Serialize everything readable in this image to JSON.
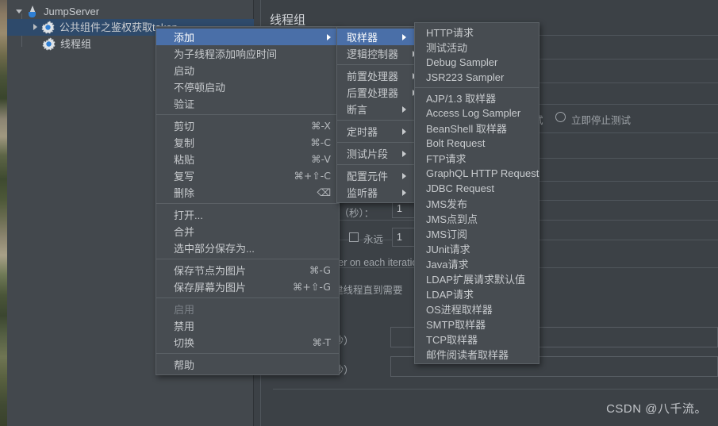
{
  "window": {
    "app": "JMeter",
    "tree": {
      "root": {
        "label": "JumpServer",
        "icon": "jmeter-icon"
      },
      "children": [
        {
          "label": "公共组件之鉴权获取token",
          "icon": "gear-icon",
          "selected": true,
          "expandable": true
        },
        {
          "label": "线程组",
          "icon": "gear-icon",
          "selected": false,
          "expandable": false
        }
      ]
    }
  },
  "content": {
    "title": "线程组",
    "action_label": "试",
    "stop_test_now_label": "立即停止测试",
    "ramp_label": "间（秒）：",
    "ramp_value": "1",
    "forever_label": "永远",
    "loop_value": "1",
    "iteration_text": "ser on each iteratio",
    "delay_thread_text": "建线程直到需要",
    "duration_label": "持续时间（秒）",
    "startup_delay_label": "启动延迟（秒）",
    "watermark": "CSDN @八千流。"
  },
  "menus": {
    "main": {
      "name": "context-menu",
      "groups": [
        [
          {
            "label": "添加",
            "submenu": true,
            "selected": true
          },
          {
            "label": "为子线程添加响应时间"
          },
          {
            "label": "启动"
          },
          {
            "label": "不停顿启动"
          },
          {
            "label": "验证"
          }
        ],
        [
          {
            "label": "剪切",
            "accel": "⌘-X"
          },
          {
            "label": "复制",
            "accel": "⌘-C"
          },
          {
            "label": "粘贴",
            "accel": "⌘-V"
          },
          {
            "label": "复写",
            "accel": "⌘+⇧-C"
          },
          {
            "label": "删除",
            "accel": "⌫"
          }
        ],
        [
          {
            "label": "打开..."
          },
          {
            "label": "合并"
          },
          {
            "label": "选中部分保存为..."
          }
        ],
        [
          {
            "label": "保存节点为图片",
            "accel": "⌘-G"
          },
          {
            "label": "保存屏幕为图片",
            "accel": "⌘+⇧-G"
          }
        ],
        [
          {
            "label": "启用",
            "disabled": true
          },
          {
            "label": "禁用"
          },
          {
            "label": "切换",
            "accel": "⌘-T"
          }
        ],
        [
          {
            "label": "帮助"
          }
        ]
      ]
    },
    "add": {
      "name": "add-submenu",
      "groups": [
        [
          {
            "label": "取样器",
            "submenu": true,
            "selected": true
          },
          {
            "label": "逻辑控制器",
            "submenu": true
          }
        ],
        [
          {
            "label": "前置处理器",
            "submenu": true
          },
          {
            "label": "后置处理器",
            "submenu": true
          },
          {
            "label": "断言",
            "submenu": true
          }
        ],
        [
          {
            "label": "定时器",
            "submenu": true
          }
        ],
        [
          {
            "label": "测试片段",
            "submenu": true
          }
        ],
        [
          {
            "label": "配置元件",
            "submenu": true
          },
          {
            "label": "监听器",
            "submenu": true
          }
        ]
      ]
    },
    "sampler": {
      "name": "sampler-submenu",
      "groups": [
        [
          {
            "label": "HTTP请求"
          },
          {
            "label": "测试活动"
          },
          {
            "label": "Debug Sampler"
          },
          {
            "label": "JSR223 Sampler"
          }
        ],
        [
          {
            "label": "AJP/1.3 取样器"
          },
          {
            "label": "Access Log Sampler"
          },
          {
            "label": "BeanShell 取样器"
          },
          {
            "label": "Bolt Request"
          },
          {
            "label": "FTP请求"
          },
          {
            "label": "GraphQL HTTP Request"
          },
          {
            "label": "JDBC Request"
          },
          {
            "label": "JMS发布"
          },
          {
            "label": "JMS点到点"
          },
          {
            "label": "JMS订阅"
          },
          {
            "label": "JUnit请求"
          },
          {
            "label": "Java请求"
          },
          {
            "label": "LDAP扩展请求默认值"
          },
          {
            "label": "LDAP请求"
          },
          {
            "label": "OS进程取样器"
          },
          {
            "label": "SMTP取样器"
          },
          {
            "label": "TCP取样器"
          },
          {
            "label": "邮件阅读者取样器"
          }
        ]
      ]
    }
  },
  "colors": {
    "panel_bg": "#3c4146",
    "tree_bg": "#43484d",
    "menu_bg": "#474c51",
    "menu_border": "#5b6166",
    "highlight": "#4a6fa8",
    "tree_select": "#2e4a6b",
    "text": "#c7cacd",
    "text_disabled": "#7b8187"
  }
}
